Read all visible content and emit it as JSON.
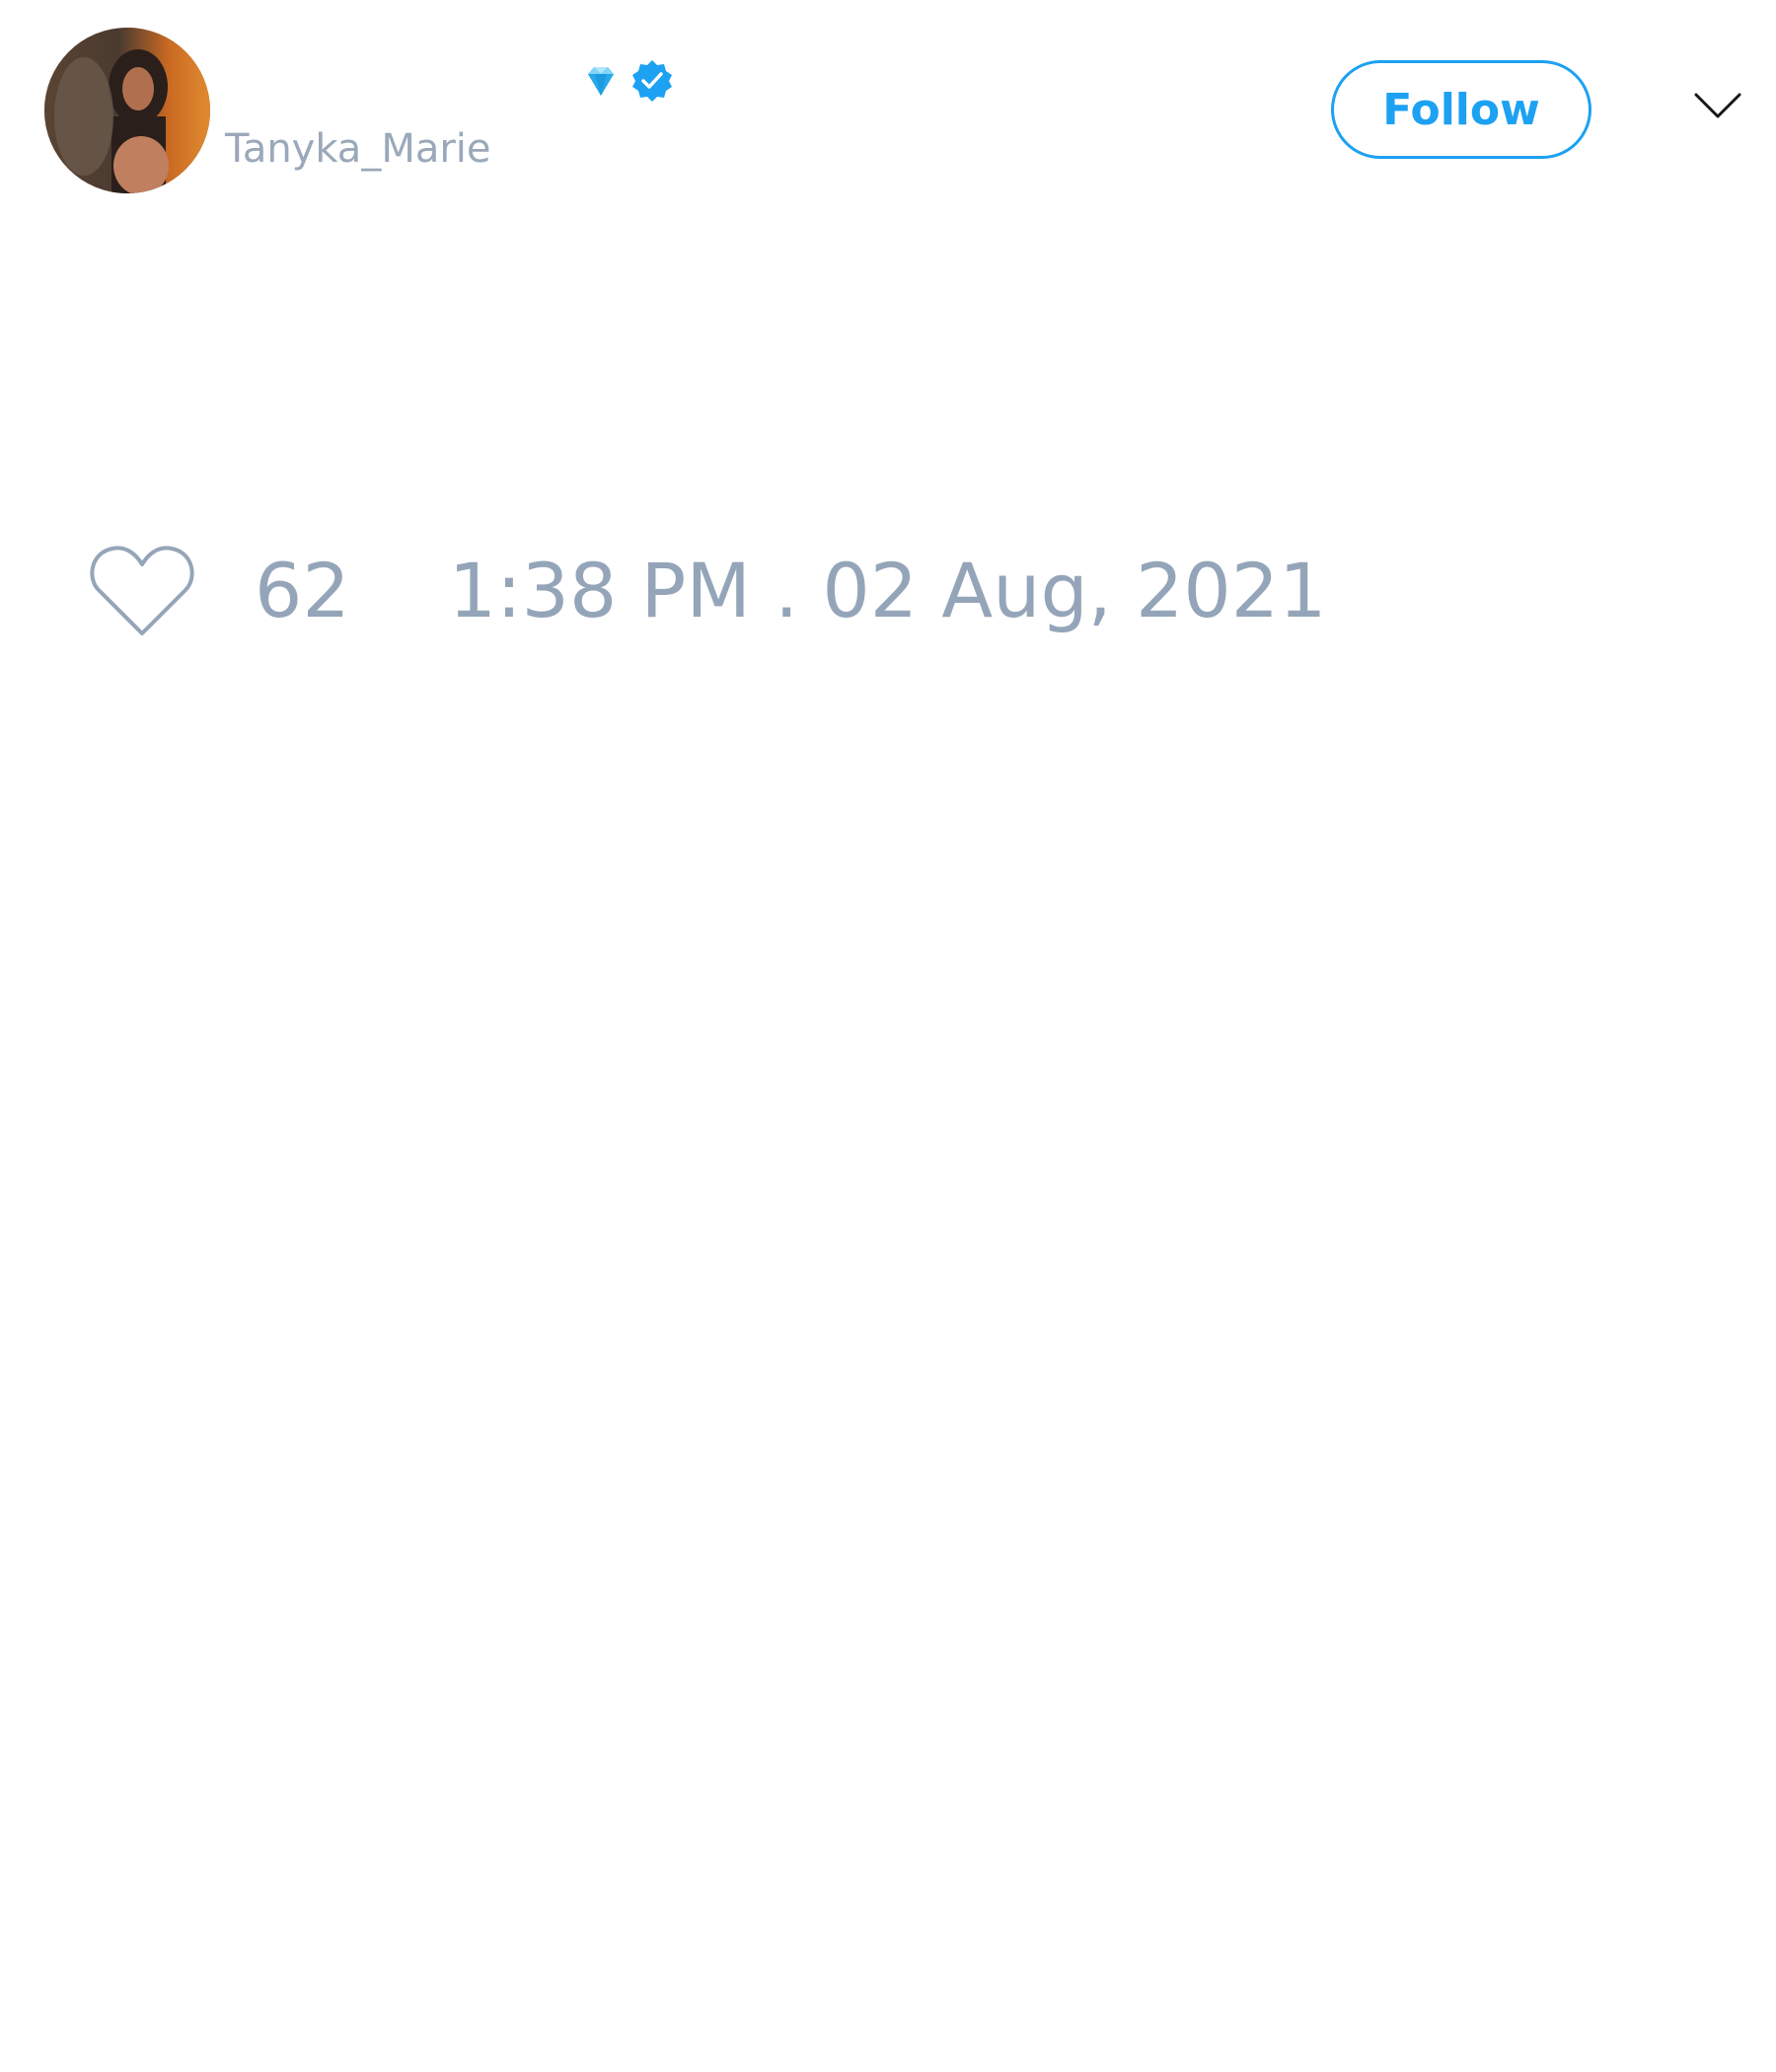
{
  "author": {
    "display_name": "",
    "handle": "Tanyka_Marie",
    "badges": [
      "gem-icon",
      "verified-badge-icon"
    ]
  },
  "actions": {
    "follow_label": "Follow",
    "menu_icon": "chevron-down-icon"
  },
  "stats": {
    "like_icon": "heart-outline-icon",
    "likes": "62",
    "timestamp": "1:38 PM . 02 Aug, 2021"
  },
  "colors": {
    "accent": "#1da1f2",
    "muted_text": "#95a5b9",
    "background": "#ffffff"
  }
}
